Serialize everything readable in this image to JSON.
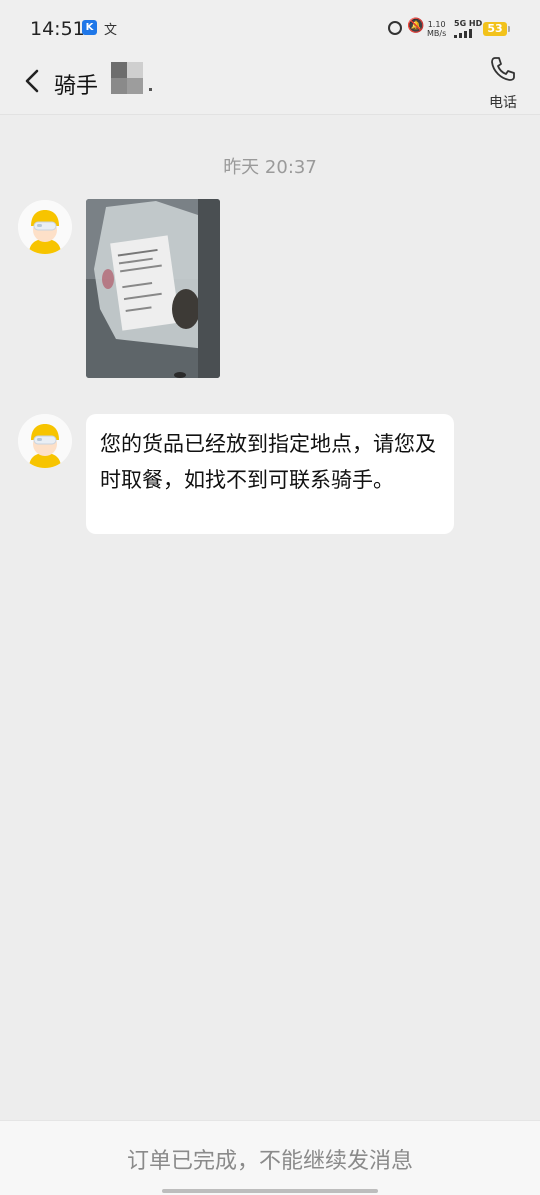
{
  "status_bar": {
    "time": "14:51",
    "app_icon_k": "K",
    "app_icon_wen": "文",
    "network_speed_value": "1.10",
    "network_speed_unit": "MB/s",
    "signal_label": "5G HD",
    "battery": "53"
  },
  "header": {
    "title": "骑手",
    "phone_label": "电话"
  },
  "messages": {
    "timestamp": "昨天 20:37",
    "text_message": "您的货品已经放到指定地点，请您及时取餐，如找不到可联系骑手。"
  },
  "footer": {
    "notice": "订单已完成，不能继续发消息"
  },
  "colors": {
    "background": "#ededed",
    "bubble": "#ffffff",
    "rider_helmet": "#f7c400",
    "battery": "#f2c21b"
  }
}
